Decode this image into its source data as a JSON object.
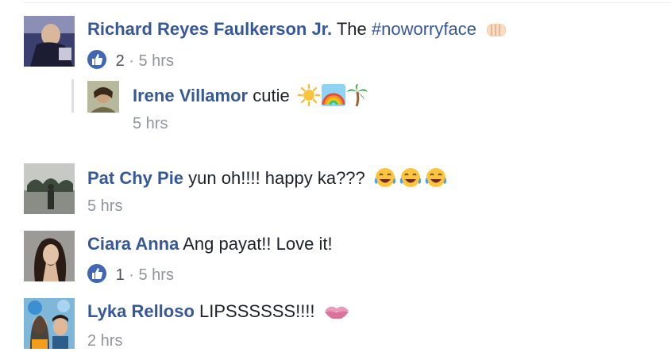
{
  "comments": [
    {
      "author": "Richard Reyes Faulkerson Jr.",
      "text_before": "The",
      "hashtag": "#noworryface",
      "emoji": "fist-bump-emoji",
      "likes": "2",
      "sep": "·",
      "time": "5 hrs"
    },
    {
      "author": "Irene Villamor",
      "text": "cutie",
      "emoji": [
        "sun-emoji",
        "rainbow-emoji",
        "palm-tree-emoji"
      ],
      "time": "5 hrs"
    },
    {
      "author": "Pat Chy Pie",
      "text": "yun oh!!!! happy ka???",
      "emoji": [
        "tears-of-joy-emoji",
        "tears-of-joy-emoji",
        "tears-of-joy-emoji"
      ],
      "time": "5 hrs"
    },
    {
      "author": "Ciara Anna",
      "text": "Ang payat!! Love it!",
      "likes": "1",
      "sep": "·",
      "time": "5 hrs"
    },
    {
      "author": "Lyka Relloso",
      "text": "LIPSSSSSS!!!!",
      "emoji": "kiss-mark-emoji",
      "time": "2 hrs"
    }
  ],
  "colors": {
    "name": "#365899",
    "text": "#1d2129",
    "meta": "#90949c",
    "like_badge": "#4267b2"
  }
}
